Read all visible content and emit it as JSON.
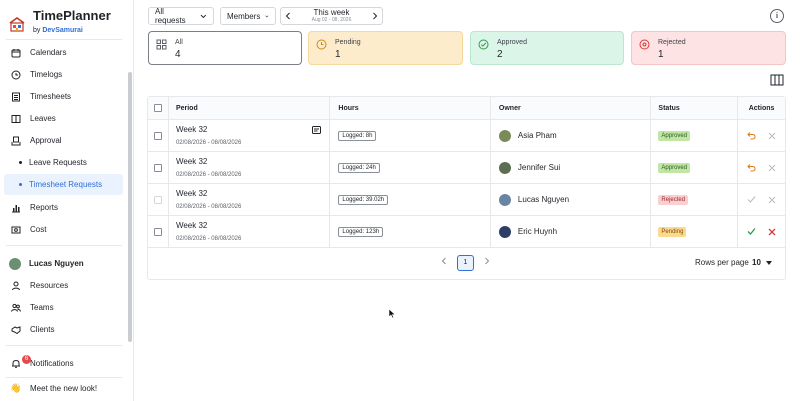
{
  "brand": {
    "title": "TimePlanner",
    "by": "by",
    "company": "DevSamurai"
  },
  "sidebar": {
    "items": [
      {
        "label": "Calendars",
        "icon": "calendar-icon"
      },
      {
        "label": "Timelogs",
        "icon": "clock-icon"
      },
      {
        "label": "Timesheets",
        "icon": "timesheet-icon"
      },
      {
        "label": "Leaves",
        "icon": "leaves-icon"
      },
      {
        "label": "Approval",
        "icon": "approval-icon"
      },
      {
        "label": "Leave Requests",
        "icon": "bullet"
      },
      {
        "label": "Timesheet Requests",
        "icon": "bullet"
      },
      {
        "label": "Reports",
        "icon": "bar-chart-icon"
      },
      {
        "label": "Cost",
        "icon": "cost-icon"
      }
    ],
    "user": {
      "name": "Lucas Nguyen"
    },
    "admin_items": [
      {
        "label": "Resources",
        "icon": "user-icon"
      },
      {
        "label": "Teams",
        "icon": "team-icon"
      },
      {
        "label": "Clients",
        "icon": "handshake-icon"
      }
    ],
    "notifications": {
      "label": "Notifications",
      "count": "6"
    },
    "footer": {
      "emoji": "👋",
      "label": "Meet the new look!"
    }
  },
  "filters": {
    "requests": "All requests",
    "members": "Members",
    "week_title": "This week",
    "week_range": "Aug 02 - 08, 2026"
  },
  "summary": [
    {
      "label": "All",
      "value": "4",
      "icon": "grid-icon",
      "color": "#ffffff"
    },
    {
      "label": "Pending",
      "value": "1",
      "icon": "pending-clock-icon",
      "color": "#fdeccc"
    },
    {
      "label": "Approved",
      "value": "2",
      "icon": "check-circle-icon",
      "color": "#dcf5e9"
    },
    {
      "label": "Rejected",
      "value": "1",
      "icon": "x-circle-icon",
      "color": "#fde3e3"
    }
  ],
  "table": {
    "headers": {
      "period": "Period",
      "hours": "Hours",
      "owner": "Owner",
      "status": "Status",
      "actions": "Actions"
    },
    "rows": [
      {
        "period": "Week 32",
        "dates": "02/08/2026 - 08/08/2026",
        "hours": "Logged: 8h",
        "owner": "Asia Pham",
        "status": "Approved",
        "has_note": true
      },
      {
        "period": "Week 32",
        "dates": "02/08/2026 - 08/08/2026",
        "hours": "Logged: 24h",
        "owner": "Jennifer Sui",
        "status": "Approved",
        "has_note": false
      },
      {
        "period": "Week 32",
        "dates": "02/08/2026 - 08/08/2026",
        "hours": "Logged: 39.02h",
        "owner": "Lucas Nguyen",
        "status": "Rejected",
        "has_note": false
      },
      {
        "period": "Week 32",
        "dates": "02/08/2026 - 08/08/2026",
        "hours": "Logged: 123h",
        "owner": "Eric Huynh",
        "status": "Pending",
        "has_note": false
      }
    ]
  },
  "pagination": {
    "page": "1",
    "rows_label": "Rows per page",
    "rows_value": "10"
  },
  "colors": {
    "accent": "#2f6fd6",
    "approved": "#bfe6a5",
    "rejected": "#f9d0d0",
    "pending": "#fdd98f",
    "undo": "#e07b1a",
    "reject_x": "#d63a3a",
    "approve_check": "#2e9b4d"
  }
}
